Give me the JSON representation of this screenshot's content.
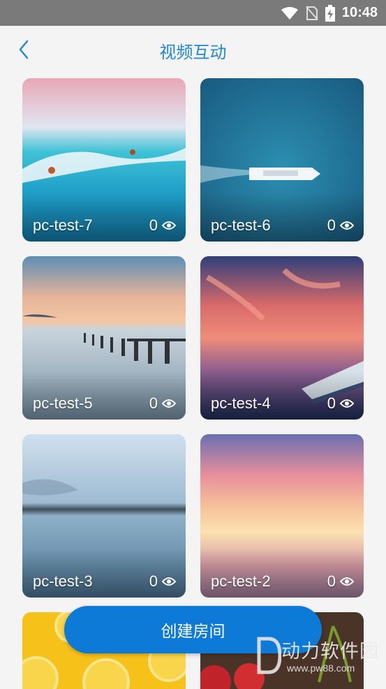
{
  "status_bar": {
    "time": "10:48"
  },
  "header": {
    "title": "视频互动"
  },
  "rooms": [
    {
      "name": "pc-test-7",
      "views": "0"
    },
    {
      "name": "pc-test-6",
      "views": "0"
    },
    {
      "name": "pc-test-5",
      "views": "0"
    },
    {
      "name": "pc-test-4",
      "views": "0"
    },
    {
      "name": "pc-test-3",
      "views": "0"
    },
    {
      "name": "pc-test-2",
      "views": "0"
    }
  ],
  "create_button": {
    "label": "创建房间"
  },
  "watermark": {
    "text": "动力软件园",
    "url": "www.pw88.com"
  },
  "colors": {
    "accent": "#1f86d8",
    "button": "#0e7ad8",
    "status_bar": "#7a7a7a"
  }
}
